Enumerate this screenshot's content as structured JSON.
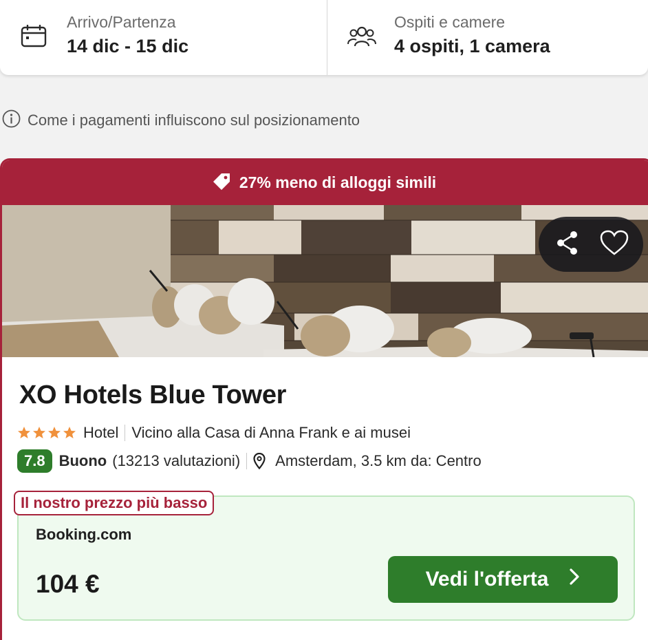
{
  "search": {
    "dates_label": "Arrivo/Partenza",
    "dates_value": "14 dic - 15 dic",
    "guests_label": "Ospiti e camere",
    "guests_value": "4 ospiti, 1 camera",
    "dates_icon": "calendar-icon",
    "guests_icon": "group-icon"
  },
  "info": {
    "text": "Come i pagamenti influiscono sul posizionamento",
    "icon": "info-icon"
  },
  "card": {
    "banner_text": "27% meno di alloggi simili",
    "banner_icon": "tag-icon",
    "actions": {
      "share_icon": "share-icon",
      "favorite_icon": "heart-icon"
    },
    "hotel_name": "XO Hotels Blue Tower",
    "star_count": 4,
    "type": "Hotel",
    "highlight": "Vicino alla Casa di Anna Frank e ai musei",
    "score": "7.8",
    "rating_word": "Buono",
    "reviews": "(13213 valutazioni)",
    "location": "Amsterdam, 3.5 km da: Centro",
    "offer": {
      "tag": "Il nostro prezzo più basso",
      "provider": "Booking.com",
      "price": "104 €",
      "cta_label": "Vedi l'offerta"
    }
  },
  "colors": {
    "brand_red": "#a6223a",
    "green": "#2e7d2b",
    "star_orange": "#f0913c",
    "offer_bg": "#effaef"
  }
}
